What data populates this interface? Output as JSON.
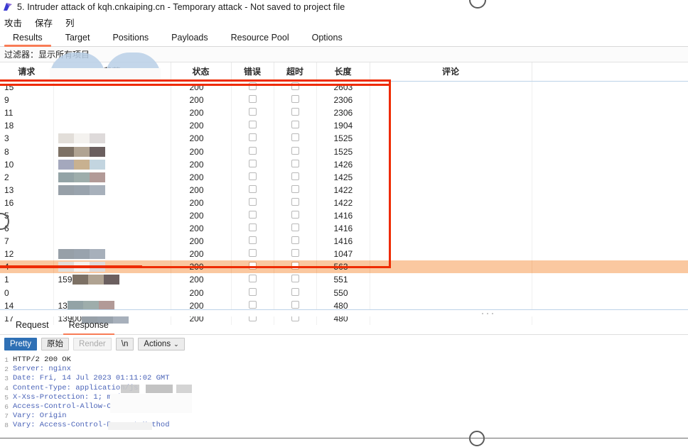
{
  "window": {
    "title": "5. Intruder attack of kqh.cnkaiping.cn - Temporary attack - Not saved to project file",
    "icon": "burp-intruder-icon"
  },
  "accent_color": "#f87c56",
  "selection_color": "#fac8a0",
  "annotation_color": "#ee2b00",
  "menubar": {
    "items": [
      {
        "label": "攻击"
      },
      {
        "label": "保存"
      },
      {
        "label": "列"
      }
    ]
  },
  "tabs": [
    {
      "label": "Results",
      "active": true
    },
    {
      "label": "Target",
      "active": false
    },
    {
      "label": "Positions",
      "active": false
    },
    {
      "label": "Payloads",
      "active": false
    },
    {
      "label": "Resource Pool",
      "active": false
    },
    {
      "label": "Options",
      "active": false
    }
  ],
  "filter": {
    "label": "过滤器：显示所有项目"
  },
  "results_table": {
    "columns": [
      {
        "key": "request",
        "label": "请求"
      },
      {
        "key": "payload",
        "label": "载荷"
      },
      {
        "key": "status",
        "label": "状态"
      },
      {
        "key": "error",
        "label": "错误"
      },
      {
        "key": "timeout",
        "label": "超时"
      },
      {
        "key": "length",
        "label": "长度"
      },
      {
        "key": "comment",
        "label": "评论"
      }
    ],
    "rows": [
      {
        "request": "15",
        "payload": "",
        "status": "200",
        "error": false,
        "timeout": false,
        "length": "2603",
        "comment": "",
        "selected": false,
        "redacted": false
      },
      {
        "request": "9",
        "payload": "",
        "status": "200",
        "error": false,
        "timeout": false,
        "length": "2306",
        "comment": "",
        "selected": false,
        "redacted": false
      },
      {
        "request": "11",
        "payload": "",
        "status": "200",
        "error": false,
        "timeout": false,
        "length": "2306",
        "comment": "",
        "selected": false,
        "redacted": false
      },
      {
        "request": "18",
        "payload": "",
        "status": "200",
        "error": false,
        "timeout": false,
        "length": "1904",
        "comment": "",
        "selected": false,
        "redacted": false
      },
      {
        "request": "3",
        "payload": "",
        "status": "200",
        "error": false,
        "timeout": false,
        "length": "1525",
        "comment": "",
        "selected": false,
        "redacted": true
      },
      {
        "request": "8",
        "payload": "",
        "status": "200",
        "error": false,
        "timeout": false,
        "length": "1525",
        "comment": "",
        "selected": false,
        "redacted": true
      },
      {
        "request": "10",
        "payload": "",
        "status": "200",
        "error": false,
        "timeout": false,
        "length": "1426",
        "comment": "",
        "selected": false,
        "redacted": true
      },
      {
        "request": "2",
        "payload": "",
        "status": "200",
        "error": false,
        "timeout": false,
        "length": "1425",
        "comment": "",
        "selected": false,
        "redacted": true
      },
      {
        "request": "13",
        "payload": "",
        "status": "200",
        "error": false,
        "timeout": false,
        "length": "1422",
        "comment": "",
        "selected": false,
        "redacted": true
      },
      {
        "request": "16",
        "payload": "",
        "status": "200",
        "error": false,
        "timeout": false,
        "length": "1422",
        "comment": "",
        "selected": false,
        "redacted": false
      },
      {
        "request": "5",
        "payload": "",
        "status": "200",
        "error": false,
        "timeout": false,
        "length": "1416",
        "comment": "",
        "selected": false,
        "redacted": false
      },
      {
        "request": "6",
        "payload": "",
        "status": "200",
        "error": false,
        "timeout": false,
        "length": "1416",
        "comment": "",
        "selected": false,
        "redacted": false
      },
      {
        "request": "7",
        "payload": "",
        "status": "200",
        "error": false,
        "timeout": false,
        "length": "1416",
        "comment": "",
        "selected": false,
        "redacted": false
      },
      {
        "request": "12",
        "payload": "",
        "status": "200",
        "error": false,
        "timeout": false,
        "length": "1047",
        "comment": "",
        "selected": false,
        "redacted": true
      },
      {
        "request": "4",
        "payload": "",
        "status": "200",
        "error": false,
        "timeout": false,
        "length": "563",
        "comment": "",
        "selected": true,
        "redacted": true
      },
      {
        "request": "1",
        "payload": "159",
        "status": "200",
        "error": false,
        "timeout": false,
        "length": "551",
        "comment": "",
        "selected": false,
        "redacted": true
      },
      {
        "request": "0",
        "payload": "",
        "status": "200",
        "error": false,
        "timeout": false,
        "length": "550",
        "comment": "",
        "selected": false,
        "redacted": false
      },
      {
        "request": "14",
        "payload": "13",
        "status": "200",
        "error": false,
        "timeout": false,
        "length": "480",
        "comment": "",
        "selected": false,
        "redacted": true
      },
      {
        "request": "17",
        "payload": "13900",
        "status": "200",
        "error": false,
        "timeout": false,
        "length": "480",
        "comment": "",
        "selected": false,
        "redacted": true
      }
    ]
  },
  "detail": {
    "tabs": [
      {
        "label": "Request",
        "active": false
      },
      {
        "label": "Response",
        "active": true
      }
    ],
    "toolbar": [
      {
        "label": "Pretty",
        "state": "primary"
      },
      {
        "label": "原始",
        "state": "flat"
      },
      {
        "label": "Render",
        "state": "disabled"
      },
      {
        "label": "\\n",
        "state": "flat"
      },
      {
        "label": "Actions",
        "state": "flat",
        "caret": "⌄"
      }
    ],
    "response_lines": [
      {
        "n": "1",
        "text": "HTTP/2 200 OK",
        "style": "head1"
      },
      {
        "n": "2",
        "text": "Server: nginx",
        "style": "hdr"
      },
      {
        "n": "3",
        "text": "Date: Fri, 14 Jul 2023 01:11:02 GMT",
        "style": "hdr"
      },
      {
        "n": "4",
        "text": "Content-Type: application/js",
        "style": "hdr"
      },
      {
        "n": "5",
        "text": "X-Xss-Protection: 1; mode",
        "style": "hdr"
      },
      {
        "n": "6",
        "text": "Access-Control-Allow-Ori",
        "style": "hdr"
      },
      {
        "n": "7",
        "text": "Vary: Origin",
        "style": "hdr"
      },
      {
        "n": "8",
        "text": "Vary: Access-Control-Request-Method",
        "style": "hdr"
      }
    ]
  },
  "annotations": {
    "highlight_box_label": "red-rectangle-around-long-responses",
    "highlight_row_label": "red-line-at-selected-row",
    "circle_labels": [
      "circle-top",
      "circle-left",
      "circle-bottom"
    ]
  }
}
